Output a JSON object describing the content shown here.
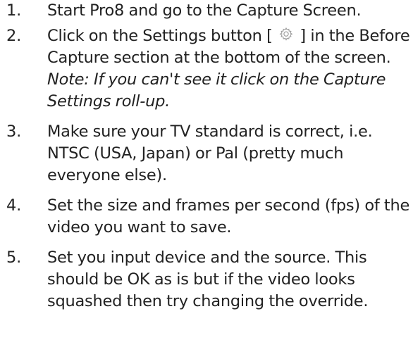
{
  "steps": [
    {
      "number": "1.",
      "text": "Start Pro8 and go to the Capture Screen."
    },
    {
      "number": "2.",
      "text_before_icon": "Click on the Settings button [",
      "icon": "gear-icon",
      "text_after_icon": "] in the Before Capture section at the bottom of the screen.",
      "note": "Note: If you can't see it click on the Capture Settings roll-up."
    },
    {
      "number": "3.",
      "text": "Make sure your TV standard is correct, i.e. NTSC (USA, Japan) or Pal (pretty much everyone else)."
    },
    {
      "number": "4.",
      "text": "Set the size and frames per second (fps) of the video you want to save."
    },
    {
      "number": "5.",
      "text": "Set you input device and the source. This should be OK as is but if the video looks squashed then try changing the override."
    }
  ],
  "colors": {
    "text": "#222222",
    "icon": "#a0a0a0",
    "background": "#ffffff"
  }
}
